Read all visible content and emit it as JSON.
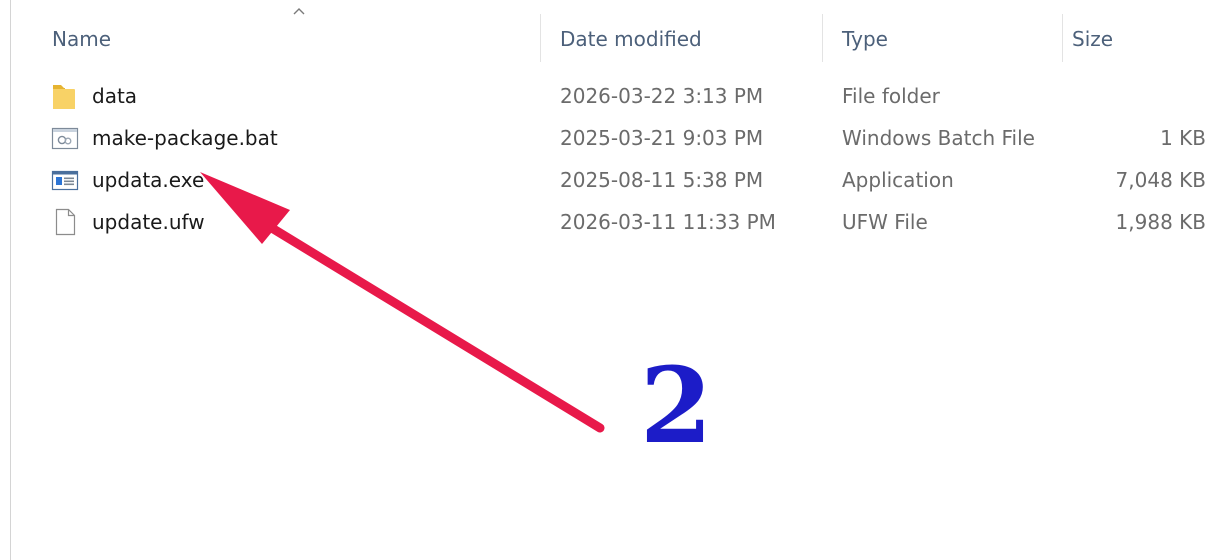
{
  "columns": {
    "name": "Name",
    "date": "Date modified",
    "type": "Type",
    "size": "Size"
  },
  "sort_indicator": "chevron-up-icon",
  "files": [
    {
      "icon": "folder-icon",
      "name": "data",
      "date": "2026-03-22 3:13 PM",
      "type": "File folder",
      "size": ""
    },
    {
      "icon": "batch-file-icon",
      "name": "make-package.bat",
      "date": "2025-03-21 9:03 PM",
      "type": "Windows Batch File",
      "size": "1 KB"
    },
    {
      "icon": "application-icon",
      "name": "updata.exe",
      "date": "2025-08-11 5:38 PM",
      "type": "Application",
      "size": "7,048 KB"
    },
    {
      "icon": "document-icon",
      "name": "update.ufw",
      "date": "2026-03-11 11:33 PM",
      "type": "UFW File",
      "size": "1,988 KB"
    }
  ],
  "annotation": {
    "number": "2",
    "arrow_color": "#e8194a",
    "number_color": "#1c1cc8"
  }
}
